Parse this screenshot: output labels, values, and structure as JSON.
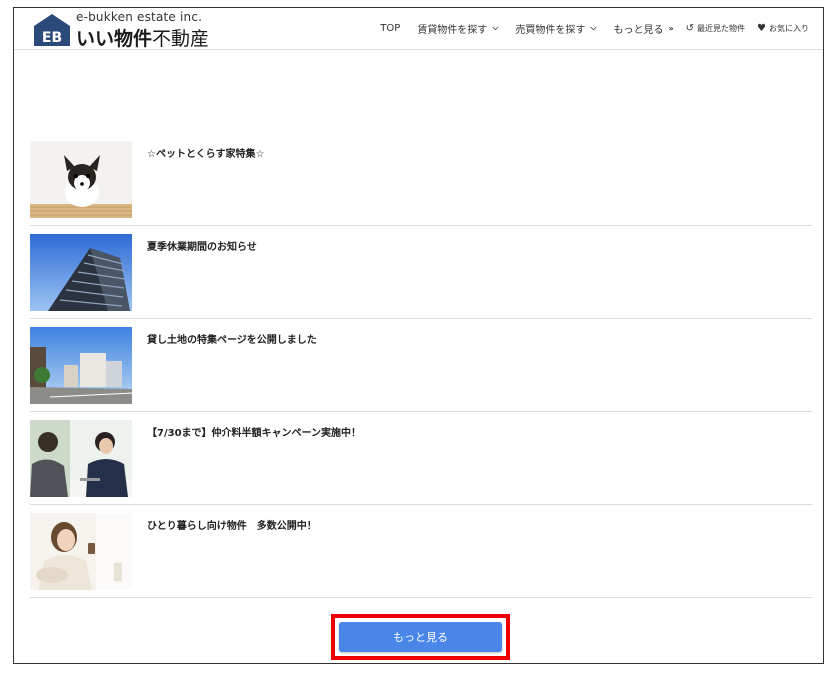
{
  "header": {
    "logo_en": "e-bukken estate inc.",
    "logo_jp_bold": "いい物件",
    "logo_jp_rest": "不動産",
    "logo_mark_text": "EB",
    "nav": [
      {
        "label": "TOP",
        "icon": ""
      },
      {
        "label": "賃貸物件を探す",
        "icon": "chevron-down-icon"
      },
      {
        "label": "売買物件を探す",
        "icon": "chevron-down-icon"
      },
      {
        "label": "もっと見る",
        "icon": "double-chevron-down-icon"
      },
      {
        "label": "最近見た物件",
        "icon": "history-icon"
      },
      {
        "label": "お気に入り",
        "icon": "heart-icon"
      }
    ]
  },
  "news": [
    {
      "title": "☆ペットとくらす家特集☆",
      "thumb": "puppy"
    },
    {
      "title": "夏季休業期間のお知らせ",
      "thumb": "building"
    },
    {
      "title": "貸し土地の特集ページを公開しました",
      "thumb": "street"
    },
    {
      "title": "【7/30まで】仲介料半額キャンペーン実施中！",
      "thumb": "meeting"
    },
    {
      "title": "ひとり暮らし向け物件　多数公開中！",
      "thumb": "woman"
    }
  ],
  "more_button": "もっと見る",
  "colors": {
    "accent": "#4a86e8",
    "highlight": "#ee0000",
    "logo": "#2b4a7a"
  }
}
